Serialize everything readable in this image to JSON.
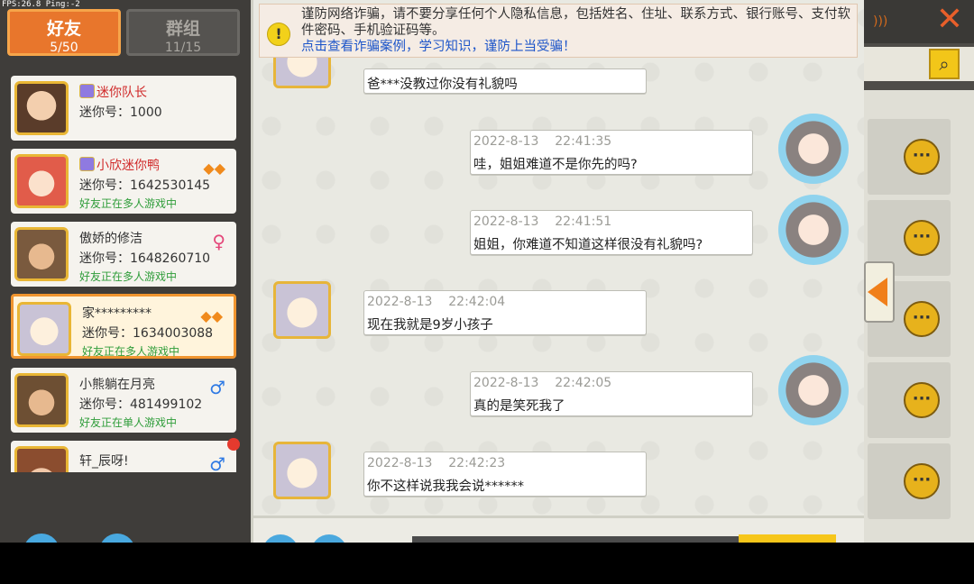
{
  "hud": {
    "fps": "FPS:26.8 Ping:-2"
  },
  "tabs": [
    {
      "label": "好友",
      "count": "5/50"
    },
    {
      "label": "群组",
      "count": "11/15"
    }
  ],
  "friends": [
    {
      "name": "迷你队长",
      "id": "迷你号：1000",
      "status": "",
      "icon": ""
    },
    {
      "name": "小欣迷你鸭",
      "id": "迷你号：1642530145",
      "status": "好友正在多人游戏中",
      "icon": "mask-icon"
    },
    {
      "name": "傲娇的修洁",
      "id": "迷你号：1648260710",
      "status": "好友正在多人游戏中",
      "icon": "female-icon"
    },
    {
      "name": "家*********",
      "id": "迷你号：1634003088",
      "status": "好友正在多人游戏中",
      "icon": "mask-icon"
    },
    {
      "name": "小熊躺在月亮",
      "id": "迷你号：481499102",
      "status": "好友正在单人游戏中",
      "icon": "male-icon"
    },
    {
      "name": "轩_辰呀!",
      "id": "",
      "status": "",
      "icon": "male-icon"
    }
  ],
  "notice": {
    "text": "谨防网络诈骗，请不要分享任何个人隐私信息，包括姓名、住址、联系方式、银行账号、支付软件密码、手机验证码等。",
    "link": "点击查看诈骗案例，学习知识，谨防上当受骗！"
  },
  "messages": [
    {
      "side": "other",
      "time": "",
      "text": "爸***没教过你没有礼貌吗"
    },
    {
      "side": "me",
      "time": "2022-8-13    22:41:35",
      "text": "哇，姐姐难道不是你先的吗?"
    },
    {
      "side": "me",
      "time": "2022-8-13    22:41:51",
      "text": "姐姐，你难道不知道这样很没有礼貌吗?"
    },
    {
      "side": "other",
      "time": "2022-8-13    22:42:04",
      "text": "现在我就是9岁小孩子"
    },
    {
      "side": "me",
      "time": "2022-8-13    22:42:05",
      "text": "真的是笑死我了"
    },
    {
      "side": "other",
      "time": "2022-8-13    22:42:23",
      "text": "你不这样说我我会说******"
    }
  ],
  "icons": {
    "close": "close-icon",
    "search": "search-icon",
    "chat": "chat-bubble-icon",
    "collapse": "arrow-left-icon",
    "warning": "warning-icon"
  },
  "colors": {
    "accent": "#e8762c",
    "link": "#1d55c9",
    "online": "#2f9d3a",
    "name_highlight": "#d02a2a"
  }
}
